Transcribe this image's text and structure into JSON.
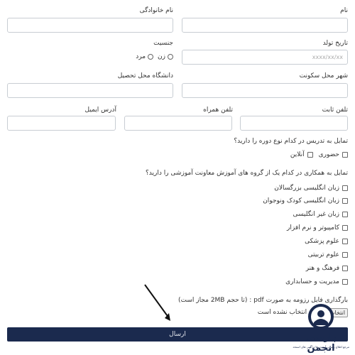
{
  "form": {
    "first_name_label": "نام",
    "last_name_label": "نام خانوادگی",
    "birth_date_label": "تاریخ تولد",
    "birth_date_placeholder": "xxxx/xx/xx",
    "gender_label": "جنسیت",
    "gender_options": [
      "زن",
      "مرد"
    ],
    "residence_city_label": "شهر محل سکونت",
    "university_label": "دانشگاه محل تحصیل",
    "phone_label": "تلفن ثابت",
    "mobile_label": "تلفن همراه",
    "email_label": "آدرس ایمیل",
    "course_type_question": "تمایل به تدریس در کدام نوع دوره را دارید؟",
    "course_type_options": [
      "حضوری",
      "آنلاین"
    ],
    "groups_question": "تمایل به همکاری در کدام یک از گروه های آموزش معاونت آموزشی را دارید؟",
    "groups_options": [
      "زبان انگلیسی بزرگسالان",
      "زبان انگلیسی کودک ونوجوان",
      "زبان غیر انگلیسی",
      "کامپیوتر و نرم افزار",
      "علوم پزشکی",
      "علوم تربیتی",
      "فرهنگ و هنر",
      "مدیریت و حسابداری"
    ],
    "resume_label": "بارگذاری فایل رزومه به صورت pdf : (تا حجم 2MB مجاز است)",
    "file_button_text": "انتخاب",
    "file_status_text": "فایلی انتخاب نشده است",
    "submit_label": "ارسال"
  },
  "watermark": {
    "brand_text": "پارسی انجمن",
    "tagline": "مرجع اطلاع رسانی آزمون ها و آگهی های استخدامی"
  },
  "colors": {
    "submit_bg": "#1b2a4e",
    "input_border": "#c8cdd3",
    "logo_dark": "#1b2a4e"
  }
}
